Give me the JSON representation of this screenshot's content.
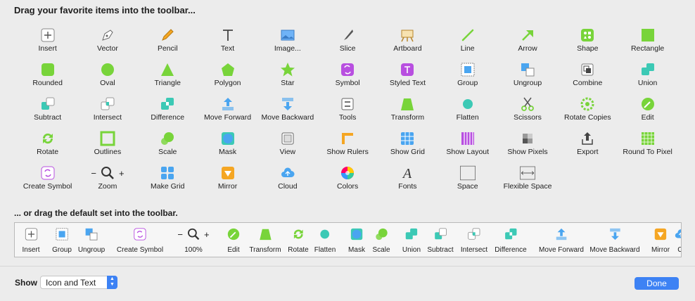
{
  "header": {
    "title": "Drag your favorite items into the toolbar..."
  },
  "grid": [
    {
      "label": "Insert",
      "icon": "insert-icon"
    },
    {
      "label": "Vector",
      "icon": "vector-pen-icon"
    },
    {
      "label": "Pencil",
      "icon": "pencil-icon"
    },
    {
      "label": "Text",
      "icon": "text-icon"
    },
    {
      "label": "Image...",
      "icon": "image-icon"
    },
    {
      "label": "Slice",
      "icon": "slice-knife-icon"
    },
    {
      "label": "Artboard",
      "icon": "artboard-easel-icon"
    },
    {
      "label": "Line",
      "icon": "line-icon"
    },
    {
      "label": "Arrow",
      "icon": "arrow-icon"
    },
    {
      "label": "Shape",
      "icon": "shape-icon"
    },
    {
      "label": "Rectangle",
      "icon": "rectangle-icon"
    },
    {
      "label": "Rounded",
      "icon": "rounded-rectangle-icon"
    },
    {
      "label": "Oval",
      "icon": "oval-icon"
    },
    {
      "label": "Triangle",
      "icon": "triangle-icon"
    },
    {
      "label": "Polygon",
      "icon": "polygon-icon"
    },
    {
      "label": "Star",
      "icon": "star-icon"
    },
    {
      "label": "Symbol",
      "icon": "symbol-icon"
    },
    {
      "label": "Styled Text",
      "icon": "styled-text-icon"
    },
    {
      "label": "Group",
      "icon": "group-icon"
    },
    {
      "label": "Ungroup",
      "icon": "ungroup-icon"
    },
    {
      "label": "Combine",
      "icon": "combine-icon"
    },
    {
      "label": "Union",
      "icon": "union-icon"
    },
    {
      "label": "Subtract",
      "icon": "subtract-icon"
    },
    {
      "label": "Intersect",
      "icon": "intersect-icon"
    },
    {
      "label": "Difference",
      "icon": "difference-icon"
    },
    {
      "label": "Move Forward",
      "icon": "move-forward-icon"
    },
    {
      "label": "Move Backward",
      "icon": "move-backward-icon"
    },
    {
      "label": "Tools",
      "icon": "tools-icon"
    },
    {
      "label": "Transform",
      "icon": "transform-icon"
    },
    {
      "label": "Flatten",
      "icon": "flatten-icon"
    },
    {
      "label": "Scissors",
      "icon": "scissors-icon"
    },
    {
      "label": "Rotate Copies",
      "icon": "rotate-copies-icon"
    },
    {
      "label": "Edit",
      "icon": "edit-icon"
    },
    {
      "label": "Rotate",
      "icon": "rotate-icon"
    },
    {
      "label": "Outlines",
      "icon": "outlines-icon"
    },
    {
      "label": "Scale",
      "icon": "scale-icon"
    },
    {
      "label": "Mask",
      "icon": "mask-icon"
    },
    {
      "label": "View",
      "icon": "view-icon"
    },
    {
      "label": "Show Rulers",
      "icon": "rulers-icon"
    },
    {
      "label": "Show Grid",
      "icon": "grid-icon"
    },
    {
      "label": "Show Layout",
      "icon": "layout-icon"
    },
    {
      "label": "Show Pixels",
      "icon": "pixels-icon"
    },
    {
      "label": "Export",
      "icon": "export-icon"
    },
    {
      "label": "Round To Pixel",
      "icon": "round-to-pixel-icon"
    },
    {
      "label": "Create Symbol",
      "icon": "create-symbol-icon"
    },
    {
      "label": "Zoom",
      "icon": "zoom-icon"
    },
    {
      "label": "Make Grid",
      "icon": "make-grid-icon"
    },
    {
      "label": "Mirror",
      "icon": "mirror-icon"
    },
    {
      "label": "Cloud",
      "icon": "cloud-icon"
    },
    {
      "label": "Colors",
      "icon": "colors-icon"
    },
    {
      "label": "Fonts",
      "icon": "fonts-icon"
    },
    {
      "label": "Space",
      "icon": "space-icon"
    },
    {
      "label": "Flexible Space",
      "icon": "flexible-space-icon"
    }
  ],
  "default_set": {
    "title": "... or drag the default set into the toolbar.",
    "items": [
      {
        "label": "Insert",
        "icon": "insert-icon"
      },
      {
        "label": "Group",
        "icon": "group-icon"
      },
      {
        "label": "Ungroup",
        "icon": "ungroup-icon"
      },
      {
        "label": "Create Symbol",
        "icon": "create-symbol-icon"
      },
      {
        "label": "100%",
        "icon": "zoom-icon"
      },
      {
        "label": "Edit",
        "icon": "edit-icon"
      },
      {
        "label": "Transform",
        "icon": "transform-icon"
      },
      {
        "label": "Rotate",
        "icon": "rotate-icon"
      },
      {
        "label": "Flatten",
        "icon": "flatten-icon"
      },
      {
        "label": "Mask",
        "icon": "mask-icon"
      },
      {
        "label": "Scale",
        "icon": "scale-icon"
      },
      {
        "label": "Union",
        "icon": "union-icon"
      },
      {
        "label": "Subtract",
        "icon": "subtract-icon"
      },
      {
        "label": "Intersect",
        "icon": "intersect-icon"
      },
      {
        "label": "Difference",
        "icon": "difference-icon"
      },
      {
        "label": "Move Forward",
        "icon": "move-forward-icon"
      },
      {
        "label": "Move Backward",
        "icon": "move-backward-icon"
      },
      {
        "label": "Mirror",
        "icon": "mirror-icon"
      },
      {
        "label": "Cl",
        "icon": "cloud-icon"
      }
    ]
  },
  "footer": {
    "show_label": "Show",
    "show_value": "Icon and Text",
    "done_label": "Done"
  },
  "colors": {
    "accent": "#3d82f4",
    "green": "#78d43a",
    "purple": "#b84fe0",
    "orange": "#f5a623",
    "teal": "#3cc9b5"
  }
}
